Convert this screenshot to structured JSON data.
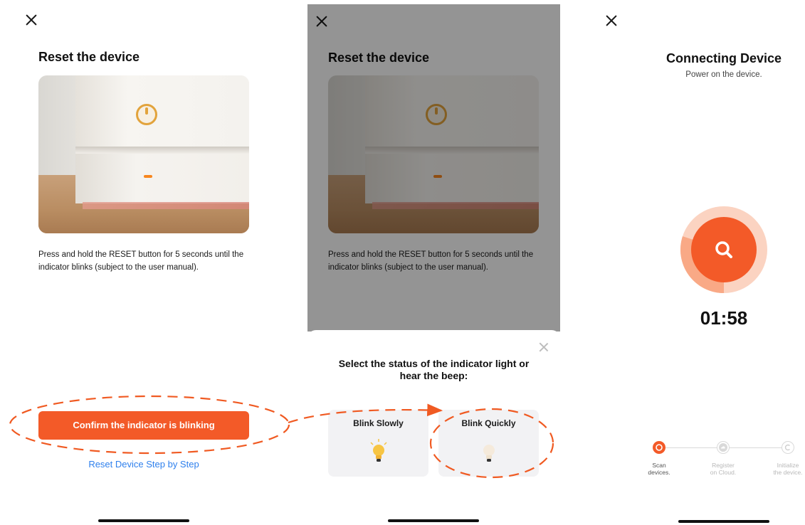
{
  "panel1": {
    "title": "Reset the device",
    "instruction_line1": "Press and hold the RESET button for 5 seconds until the",
    "instruction_line2": "indicator blinks (subject to the user manual).",
    "confirm_button": "Confirm the indicator is blinking",
    "reset_link": "Reset Device Step by Step"
  },
  "panel2": {
    "title": "Reset the device",
    "instruction_line1": "Press and hold the RESET button for 5 seconds until the",
    "instruction_line2": "indicator blinks (subject to the user manual).",
    "sheet_title_line1": "Select the status of the indicator light or",
    "sheet_title_line2": "hear the beep:",
    "options": [
      {
        "label": "Blink Slowly",
        "icon": "lightbulb-on-icon"
      },
      {
        "label": "Blink Quickly",
        "icon": "lightbulb-dim-icon"
      }
    ]
  },
  "panel3": {
    "title": "Connecting Device",
    "subtitle": "Power on the device.",
    "timer": "01:58",
    "progress_fraction": 0.3,
    "steps": [
      {
        "line1": "Scan",
        "line2": "devices.",
        "state": "active"
      },
      {
        "line1": "Register",
        "line2": "on Cloud.",
        "state": "pending"
      },
      {
        "line1": "Initialize",
        "line2": "the device.",
        "state": "pending"
      }
    ]
  },
  "colors": {
    "accent": "#f35a28",
    "link": "#2f80ed",
    "annotation": "#f05a22"
  }
}
